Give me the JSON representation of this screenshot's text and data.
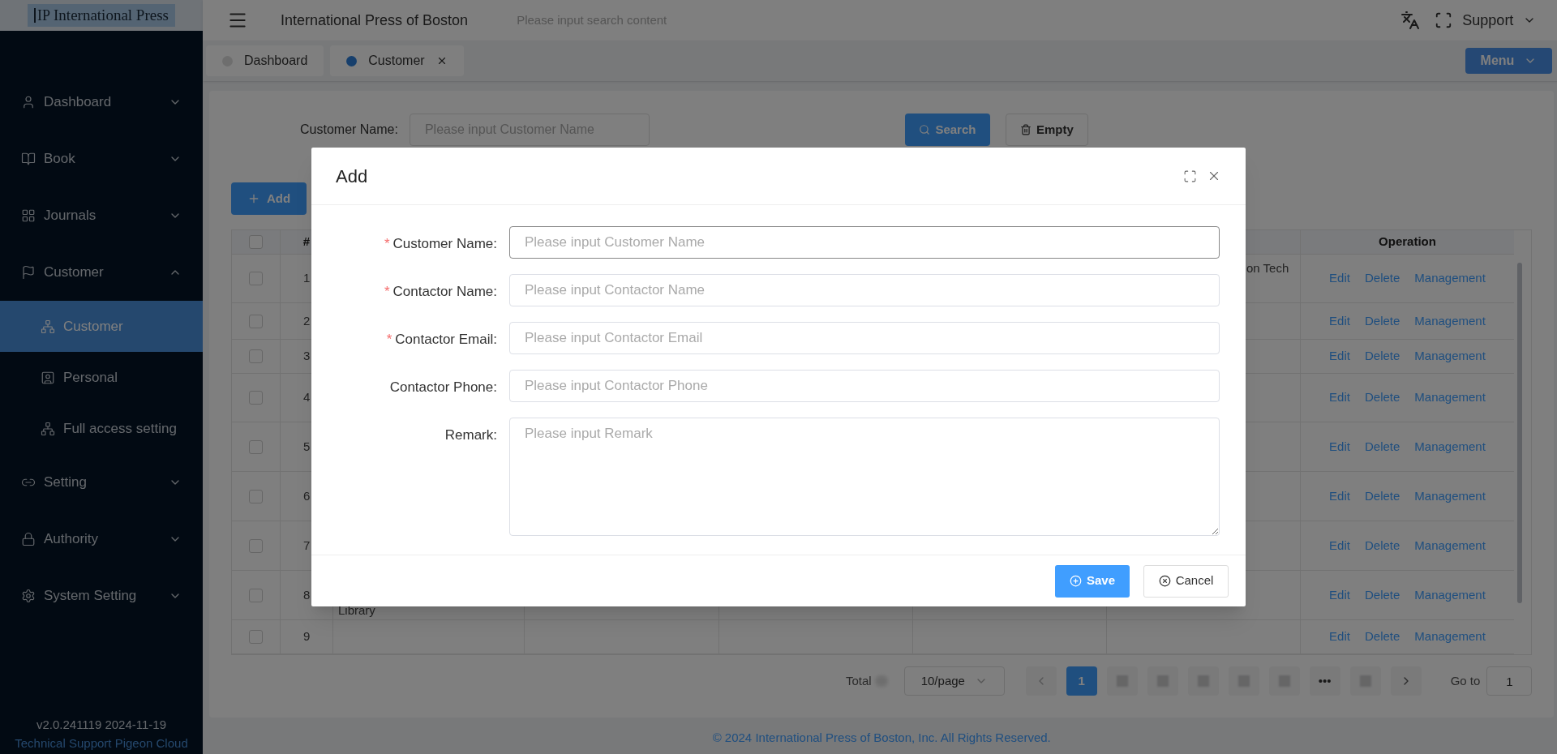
{
  "logo": {
    "mark": "IP",
    "text": "International Press"
  },
  "sidebar": {
    "items": [
      {
        "label": "Dashboard",
        "expanded": false
      },
      {
        "label": "Book",
        "expanded": false
      },
      {
        "label": "Journals",
        "expanded": false
      },
      {
        "label": "Customer",
        "expanded": true,
        "children": [
          {
            "label": "Customer",
            "selected": true
          },
          {
            "label": "Personal",
            "selected": false
          },
          {
            "label": "Full access setting",
            "selected": false
          }
        ]
      },
      {
        "label": "Setting",
        "expanded": false
      },
      {
        "label": "Authority",
        "expanded": false
      },
      {
        "label": "System Setting",
        "expanded": false
      }
    ],
    "version": "v2.0.241119 2024-11-19",
    "support": "Technical Support Pigeon Cloud"
  },
  "header": {
    "title": "International Press of Boston",
    "search_placeholder": "Please input search content",
    "support": "Support"
  },
  "tabs": [
    {
      "label": "Dashboard",
      "selected": false,
      "closable": false
    },
    {
      "label": "Customer",
      "selected": true,
      "closable": true
    }
  ],
  "menu_button": "Menu",
  "filter": {
    "label": "Customer Name:",
    "placeholder": "Please input Customer Name",
    "search": "Search",
    "empty": "Empty"
  },
  "add_button": "Add",
  "table": {
    "number_header": "#",
    "operation_header": "Operation",
    "header_checked": false,
    "rows": [
      {
        "checked": false,
        "number": "1",
        "column_7": "on Tech",
        "actions": [
          "Edit",
          "Delete",
          "Management"
        ]
      },
      {
        "checked": false,
        "number": "2",
        "actions": [
          "Edit",
          "Delete",
          "Management"
        ]
      },
      {
        "checked": false,
        "number": "3",
        "actions": [
          "Edit",
          "Delete",
          "Management"
        ]
      },
      {
        "checked": false,
        "number": "4",
        "actions": [
          "Edit",
          "Delete",
          "Management"
        ]
      },
      {
        "checked": false,
        "number": "5",
        "actions": [
          "Edit",
          "Delete",
          "Management"
        ]
      },
      {
        "checked": false,
        "number": "6",
        "actions": [
          "Edit",
          "Delete",
          "Management"
        ]
      },
      {
        "checked": false,
        "number": "7",
        "actions": [
          "Edit",
          "Delete",
          "Management"
        ]
      },
      {
        "checked": false,
        "number": "8",
        "column_3": "Library",
        "actions": [
          "Edit",
          "Delete",
          "Management"
        ]
      },
      {
        "checked": false,
        "number": "9",
        "actions": [
          "Edit",
          "Delete",
          "Management"
        ]
      }
    ]
  },
  "pagination": {
    "total": "Total",
    "page_size": "10/page",
    "pages": [
      {
        "kind": "page",
        "label": "1",
        "selected": true
      },
      {
        "kind": "blurred",
        "selected": false
      },
      {
        "kind": "blurred",
        "selected": false
      },
      {
        "kind": "blurred",
        "selected": false
      },
      {
        "kind": "blurred",
        "selected": false
      },
      {
        "kind": "blurred",
        "selected": false
      },
      {
        "kind": "more",
        "label": "•••",
        "selected": false
      },
      {
        "kind": "blurred",
        "selected": false
      }
    ],
    "goto_label": "Go to",
    "goto_value": "1"
  },
  "footer": "© 2024 International Press of Boston, Inc. All Rights Reserved.",
  "dialog": {
    "title": "Add",
    "required_mark": "*",
    "fields": [
      {
        "kind": "input",
        "label": "Customer Name:",
        "placeholder": "Please input Customer Name",
        "required": true,
        "focused": true
      },
      {
        "kind": "input",
        "label": "Contactor Name:",
        "placeholder": "Please input Contactor Name",
        "required": true,
        "focused": false
      },
      {
        "kind": "input",
        "label": "Contactor Email:",
        "placeholder": "Please input Contactor Email",
        "required": true,
        "focused": false
      },
      {
        "kind": "input",
        "label": "Contactor Phone:",
        "placeholder": "Please input Contactor Phone",
        "required": false,
        "focused": false
      },
      {
        "kind": "textarea",
        "label": "Remark:",
        "placeholder": "Please input Remark",
        "required": false,
        "focused": false
      }
    ],
    "save": "Save",
    "cancel": "Cancel"
  }
}
